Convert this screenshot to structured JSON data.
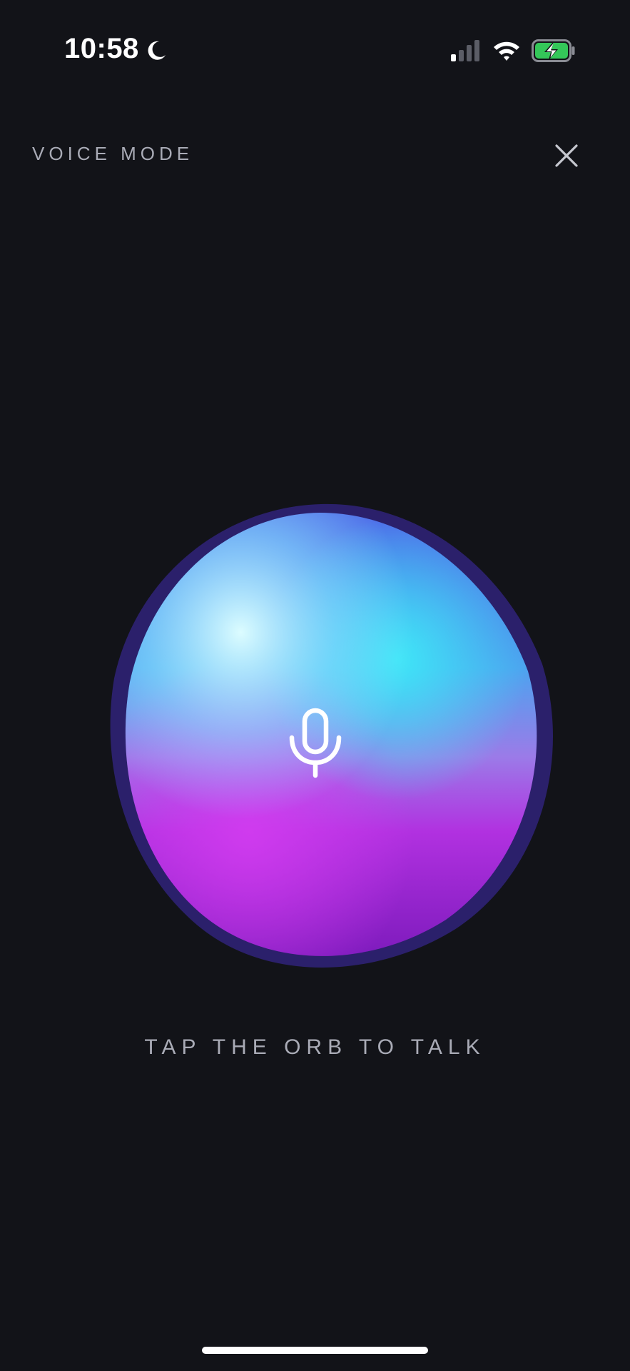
{
  "status_bar": {
    "time": "10:58",
    "focus_icon": "moon-icon",
    "signal_icon": "cellular-signal-icon",
    "wifi_icon": "wifi-icon",
    "battery_icon": "battery-charging-icon",
    "battery_color": "#34c759",
    "signal_bars_active": 1,
    "signal_bars_total": 4
  },
  "header": {
    "title": "VOICE MODE",
    "close_icon": "close-icon"
  },
  "orb": {
    "icon": "microphone-icon",
    "colors": [
      "#d7fbff",
      "#3fd8ef",
      "#2b62d9",
      "#c238e8",
      "#7d1ab8"
    ]
  },
  "hint": {
    "text": "TAP THE ORB TO TALK"
  },
  "colors": {
    "background": "#121318",
    "muted_text": "#a9abb6"
  }
}
